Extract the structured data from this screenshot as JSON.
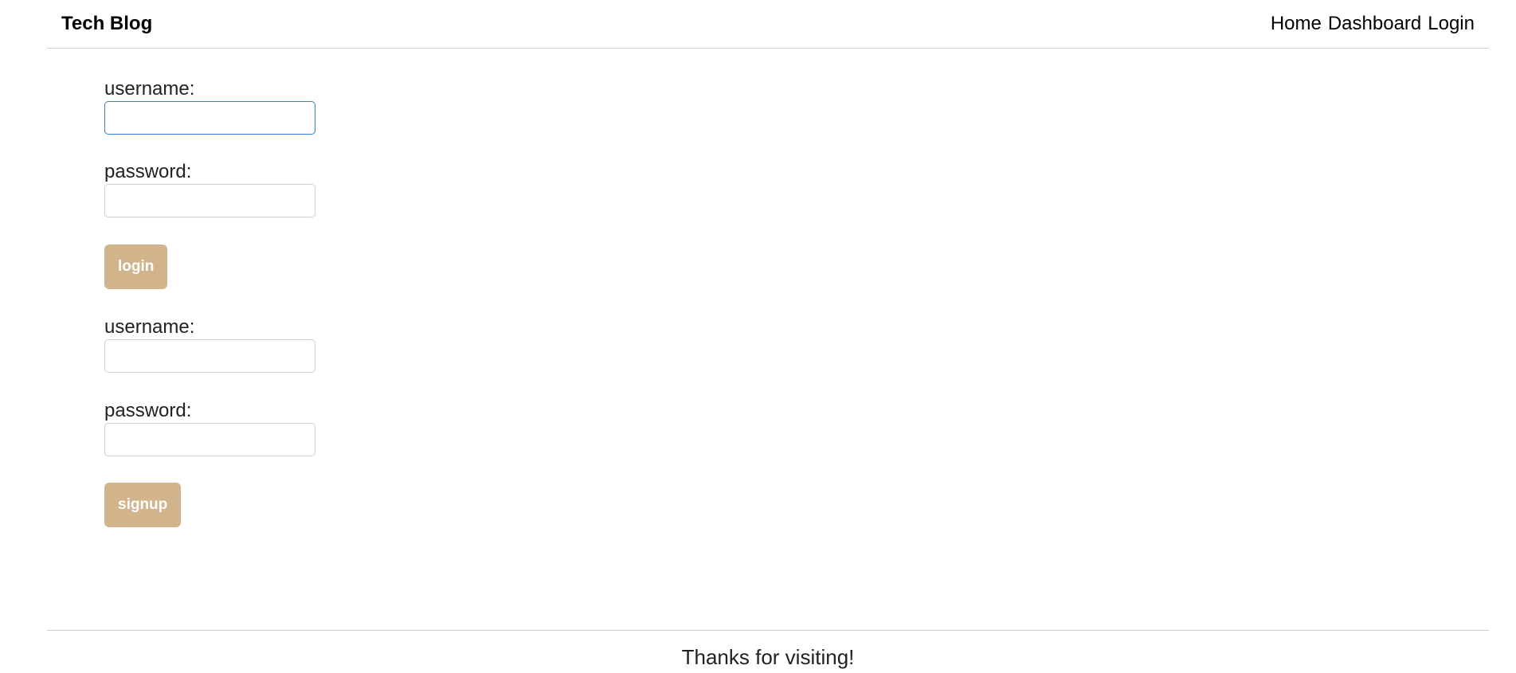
{
  "header": {
    "brand": "Tech Blog",
    "nav": [
      {
        "label": "Home"
      },
      {
        "label": "Dashboard"
      },
      {
        "label": "Login"
      }
    ]
  },
  "login_form": {
    "username_label": "username:",
    "username_value": "",
    "password_label": "password:",
    "password_value": "",
    "submit_label": "login"
  },
  "signup_form": {
    "username_label": "username:",
    "username_value": "",
    "password_label": "password:",
    "password_value": "",
    "submit_label": "signup"
  },
  "footer": {
    "text": "Thanks for visiting!"
  },
  "colors": {
    "button_bg": "#d2b48c",
    "button_text": "#ffffff",
    "focus_border": "#2a7fd4",
    "divider": "#cfcfcf"
  }
}
